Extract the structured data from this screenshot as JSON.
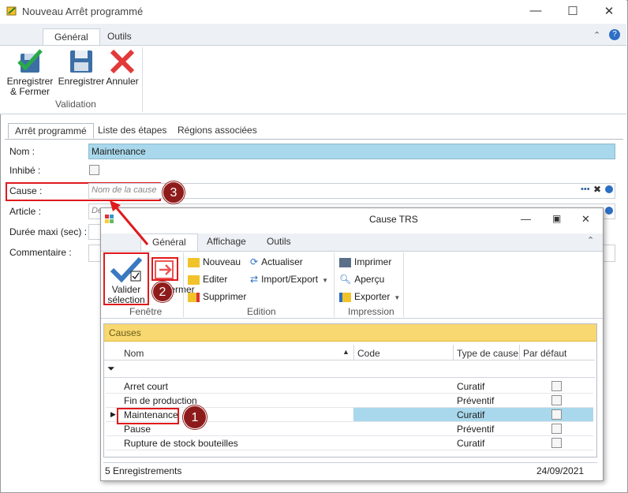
{
  "window": {
    "title": "Nouveau Arrêt programmé",
    "minimize": "—",
    "maximize": "☐",
    "close": "✕"
  },
  "ribbon": {
    "tabs": [
      "Général",
      "Outils"
    ],
    "buttons": {
      "save_close": "Enregistrer & Fermer",
      "save": "Enregistrer",
      "cancel": "Annuler"
    },
    "group_label": "Validation"
  },
  "form_tabs": [
    "Arrêt programmé",
    "Liste des étapes",
    "Régions associées"
  ],
  "form": {
    "nom_label": "Nom :",
    "nom_value": "Maintenance",
    "inhibe_label": "Inhibé :",
    "cause_label": "Cause :",
    "cause_placeholder": "Nom de la cause",
    "article_label": "Article :",
    "article_placeholder": "De",
    "duree_label": "Durée maxi (sec) :",
    "commentaire_label": "Commentaire :"
  },
  "callouts": [
    "1",
    "2",
    "3"
  ],
  "dialog": {
    "title": "Cause TRS",
    "tabs": [
      "Général",
      "Affichage",
      "Outils"
    ],
    "buttons": {
      "valider": "Valider sélection",
      "fermer": "Fermer",
      "nouveau": "Nouveau",
      "editer": "Editer",
      "supprimer": "Supprimer",
      "actualiser": "Actualiser",
      "import_export": "Import/Export",
      "imprimer": "Imprimer",
      "apercu": "Aperçu",
      "exporter": "Exporter"
    },
    "groups": {
      "fenetre": "Fenêtre",
      "edition": "Edition",
      "impression": "Impression"
    },
    "grid": {
      "caption": "Causes",
      "columns": [
        "Nom",
        "Code",
        "Type de cause",
        "Par défaut"
      ],
      "rows": [
        {
          "nom": "Arret court",
          "code": "",
          "type": "Curatif"
        },
        {
          "nom": "Fin de production",
          "code": "",
          "type": "Préventif"
        },
        {
          "nom": "Maintenance",
          "code": "",
          "type": "Curatif"
        },
        {
          "nom": "Pause",
          "code": "",
          "type": "Préventif"
        },
        {
          "nom": "Rupture de stock bouteilles",
          "code": "",
          "type": "Curatif"
        }
      ],
      "footer_count": "5 Enregistrements",
      "footer_date": "24/09/2021"
    }
  },
  "colors": {
    "accent_red": "#e0191d",
    "highlight_blue": "#a9d8ec",
    "callout": "#8e1b1b",
    "grid_caption": "#f8d870"
  }
}
